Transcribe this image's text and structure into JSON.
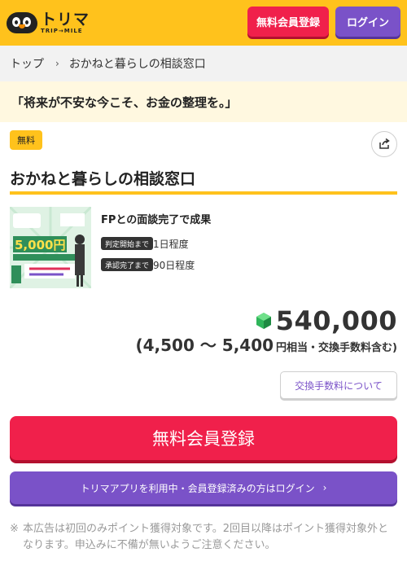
{
  "header": {
    "logo_text": "トリマ",
    "logo_sub": "TRIP→MILE",
    "register_label": "無料会員登録",
    "login_label": "ログイン"
  },
  "breadcrumb": {
    "home": "トップ",
    "current": "おかねと暮らしの相談窓口"
  },
  "catchcopy": "「将来が不安な今こそ、お金の整理を。」",
  "offer": {
    "badge": "無料",
    "title": "おかねと暮らしの相談窓口",
    "condition_title": "FPとの面談完了で成果",
    "tags": [
      {
        "label": "判定開始まで",
        "value": "1日程度"
      },
      {
        "label": "承認完了まで",
        "value": "90日程度"
      }
    ],
    "thumb_amount": "5,000円",
    "points": "540,000",
    "yen_range": "(4,500 〜 5,400",
    "yen_suffix": "円相当・交換手数料含む)",
    "fee_button": "交換手数料について"
  },
  "cta": {
    "register_label": "無料会員登録",
    "login_label": "トリマアプリを利用中・会員登録済みの方はログイン"
  },
  "notice": {
    "mark": "※",
    "text": "本広告は初回のみポイント獲得対象です。2回目以降はポイント獲得対象外となります。申込みに不備が無いようご注意ください。"
  },
  "colors": {
    "brand_yellow": "#ffc21c",
    "register_red": "#f0204b",
    "login_purple": "#7a52c8"
  }
}
